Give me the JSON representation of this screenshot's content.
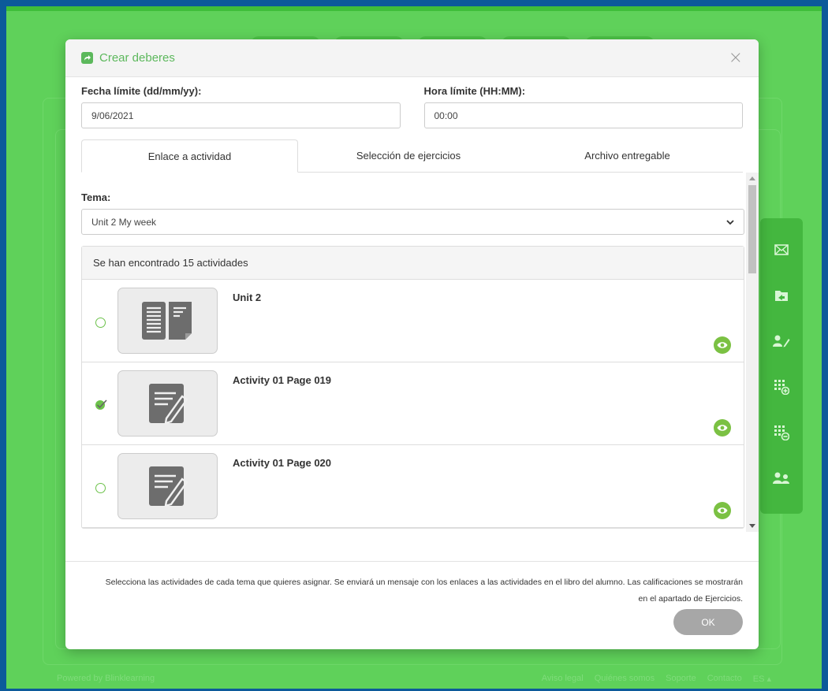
{
  "modal": {
    "title": "Crear deberes",
    "close_symbol": "×",
    "date_field": {
      "label": "Fecha límite (dd/mm/yy):",
      "value": "9/06/2021"
    },
    "time_field": {
      "label": "Hora límite (HH:MM):",
      "value": "00:00"
    },
    "tabs": [
      {
        "label": "Enlace a actividad",
        "active": true
      },
      {
        "label": "Selección de ejercicios",
        "active": false
      },
      {
        "label": "Archivo entregable",
        "active": false
      }
    ],
    "tema": {
      "label": "Tema:",
      "selected": "Unit 2 My week"
    },
    "results_header": "Se han encontrado 15 actividades",
    "activities": [
      {
        "title": "Unit 2",
        "selected": false,
        "icon": "book-icon"
      },
      {
        "title": "Activity 01 Page 019",
        "selected": true,
        "icon": "edit-document-icon"
      },
      {
        "title": "Activity 01 Page 020",
        "selected": false,
        "icon": "edit-document-icon"
      }
    ],
    "footer_text_line1": "Selecciona las actividades de cada tema que quieres asignar. Se enviará un mensaje con los enlaces a las actividades en el libro del alumno. Las calificaciones se mostrarán",
    "footer_text_line2": "en el apartado de Ejercicios.",
    "ok_label": "OK"
  },
  "background": {
    "footer_left": "Powered by Blinklearning",
    "footer_links": [
      "Aviso legal",
      "Quiénes somos",
      "Soporte",
      "Contacto",
      "ES ▴"
    ]
  },
  "colors": {
    "app_green": "#5fd15a",
    "accent_green": "#5cb85c",
    "eye_green": "#7bc143",
    "ok_gray": "#a7a7a7",
    "outer_blue": "#0c5a9a"
  }
}
